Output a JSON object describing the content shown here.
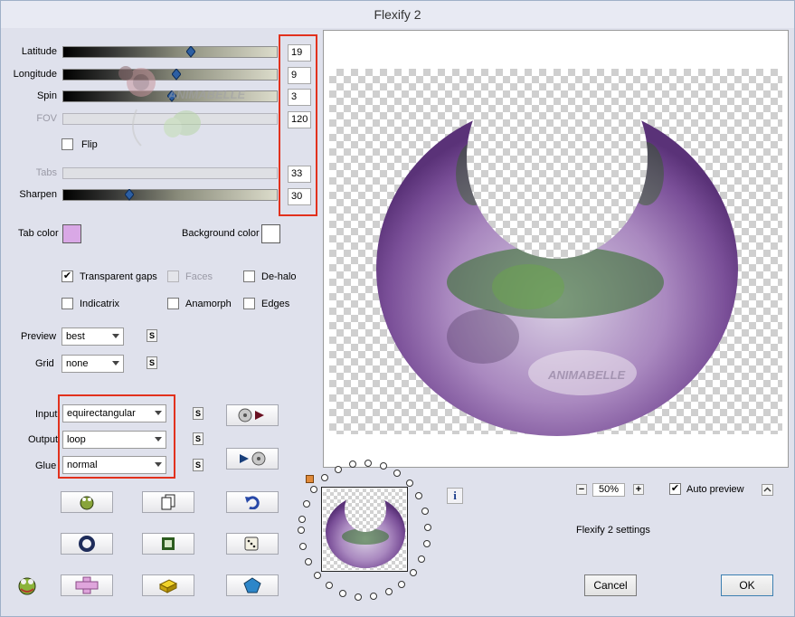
{
  "window": {
    "title": "Flexify 2"
  },
  "sliders": [
    {
      "id": "latitude",
      "label": "Latitude",
      "value": "19",
      "fraction": 0.6,
      "enabled": true
    },
    {
      "id": "longitude",
      "label": "Longitude",
      "value": "9",
      "fraction": 0.53,
      "enabled": true
    },
    {
      "id": "spin",
      "label": "Spin",
      "value": "3",
      "fraction": 0.51,
      "enabled": true
    },
    {
      "id": "fov",
      "label": "FOV",
      "value": "120",
      "enabled": false
    },
    {
      "id": "tabs",
      "label": "Tabs",
      "value": "33",
      "enabled": false
    },
    {
      "id": "sharpen",
      "label": "Sharpen",
      "value": "30",
      "fraction": 0.3,
      "enabled": true
    }
  ],
  "flip": {
    "label": "Flip",
    "checked": false
  },
  "colors": {
    "tab_color_label": "Tab color",
    "tab_color": "#d9a8e6",
    "background_color_label": "Background color",
    "background_color": "#ffffff",
    "highlight_red": "#e2311d"
  },
  "options": {
    "transparent_gaps": {
      "label": "Transparent gaps",
      "checked": true
    },
    "faces": {
      "label": "Faces",
      "checked": false,
      "enabled": false
    },
    "de_halo": {
      "label": "De-halo",
      "checked": false
    },
    "indicatrix": {
      "label": "Indicatrix",
      "checked": false
    },
    "anamorph": {
      "label": "Anamorph",
      "checked": false
    },
    "edges": {
      "label": "Edges",
      "checked": false
    }
  },
  "selects": {
    "preview": {
      "label": "Preview",
      "value": "best"
    },
    "grid": {
      "label": "Grid",
      "value": "none"
    },
    "input": {
      "label": "Input",
      "value": "equirectangular"
    },
    "output": {
      "label": "Output",
      "value": "loop"
    },
    "glue": {
      "label": "Glue",
      "value": "normal"
    }
  },
  "s_button_label": "S",
  "zoom": {
    "minus": "−",
    "value": "50%",
    "plus": "+"
  },
  "auto_preview": {
    "label": "Auto preview",
    "checked": true
  },
  "settings_text": "Flexify 2 settings",
  "buttons": {
    "cancel": "Cancel",
    "ok": "OK"
  },
  "info_glyph": "i",
  "watermark": "ANIMABELLE"
}
